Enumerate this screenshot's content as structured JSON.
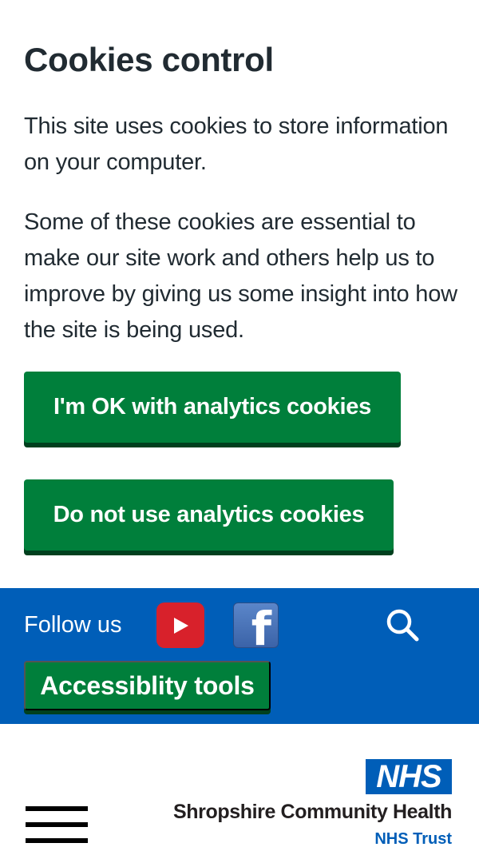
{
  "cookies": {
    "title": "Cookies control",
    "paragraph_1": "This site uses cookies to store information on your computer.",
    "paragraph_2": "Some of these cookies are essential to make our site work and others help us to improve by giving us some insight into how the site is being used.",
    "accept_label": "I'm OK with analytics cookies",
    "reject_label": "Do not use analytics cookies"
  },
  "social": {
    "follow_label": "Follow us",
    "youtube_icon": "youtube-icon",
    "facebook_icon": "facebook-icon",
    "facebook_glyph": "f",
    "search_icon": "search-icon",
    "accessibility_label": "Accessiblity tools"
  },
  "header": {
    "logo_text": "NHS",
    "org_name": "Shropshire Community Health",
    "org_type": "NHS Trust",
    "menu_icon": "hamburger-menu-icon"
  },
  "colors": {
    "nhs_blue": "#005eb8",
    "button_green": "#007f3b",
    "button_shadow": "#00401e",
    "youtube_red": "#d8212b",
    "text_dark": "#212b32"
  }
}
